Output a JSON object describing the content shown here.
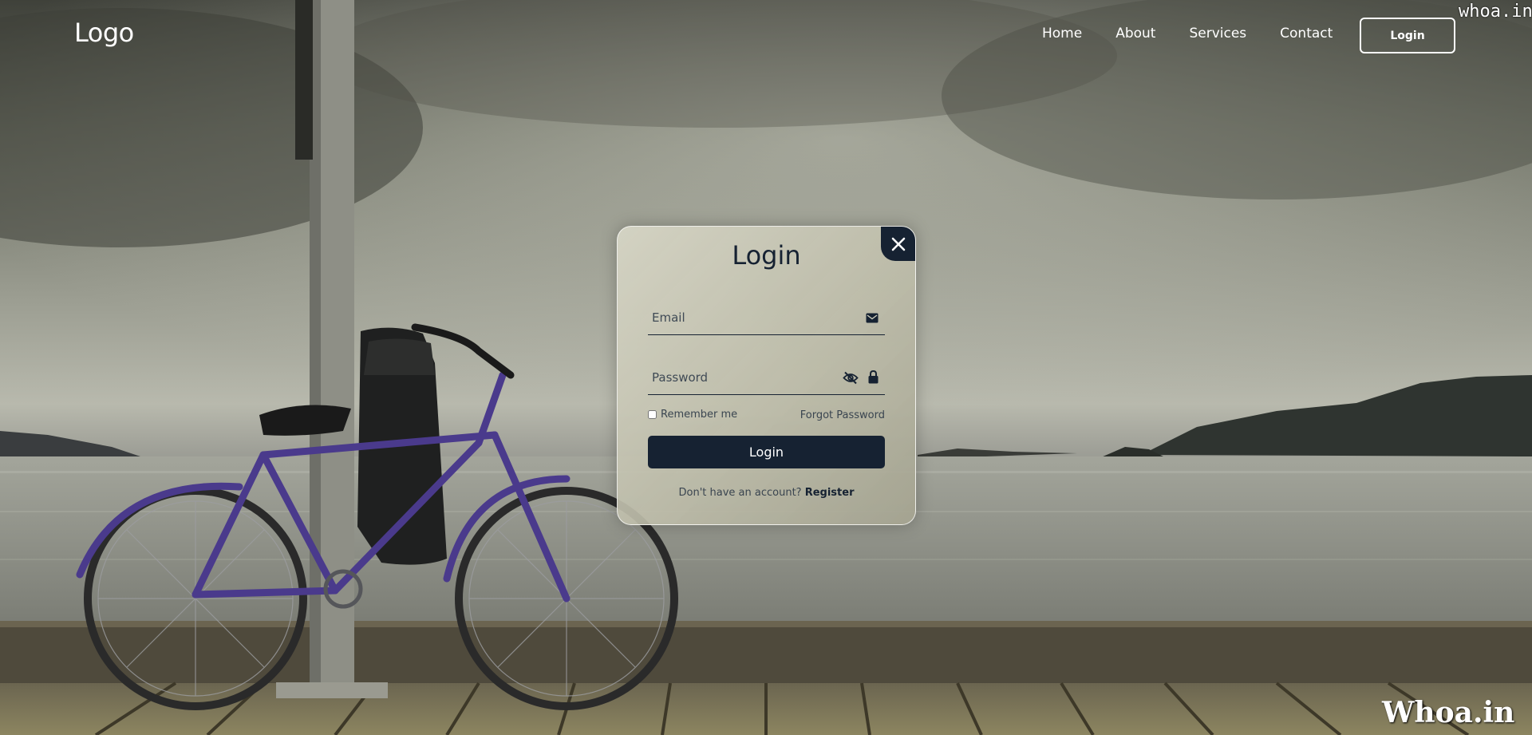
{
  "header": {
    "logo": "Logo",
    "nav": [
      "Home",
      "About",
      "Services",
      "Contact"
    ],
    "login_button": "Login"
  },
  "watermarks": {
    "top": "whoa.in",
    "bottom": "Whoa.in"
  },
  "modal": {
    "title": "Login",
    "email_placeholder": "Email",
    "password_placeholder": "Password",
    "remember_label": "Remember me",
    "forgot_label": "Forgot Password",
    "submit_label": "Login",
    "register_prompt": "Don't have an account?",
    "register_link": "Register"
  },
  "colors": {
    "accent": "#162232",
    "text_light": "#ffffff"
  },
  "icons": {
    "close": "close-icon",
    "email": "envelope-icon",
    "password_toggle": "eye-slash-icon",
    "password": "lock-icon"
  }
}
